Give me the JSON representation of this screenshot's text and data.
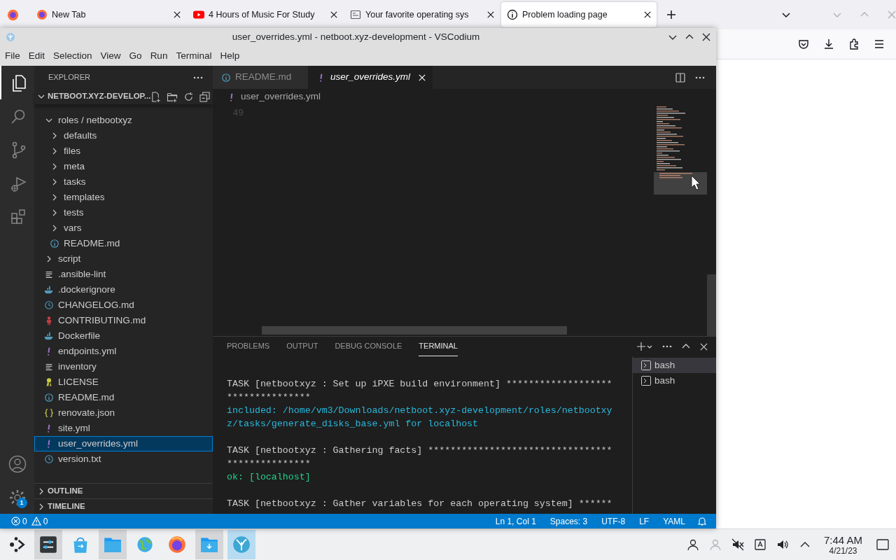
{
  "browser": {
    "tabs": [
      {
        "kind": "firefox",
        "title": "New Tab",
        "selected": false
      },
      {
        "kind": "video",
        "title": "4 Hours of Music For Study",
        "selected": false
      },
      {
        "kind": "page",
        "title": "Your favorite operating sys",
        "selected": false
      },
      {
        "kind": "info",
        "title": "Problem loading page",
        "selected": true
      }
    ]
  },
  "window": {
    "title": "user_overrides.yml - netboot.xyz-development - VSCodium"
  },
  "menu": [
    "File",
    "Edit",
    "Selection",
    "View",
    "Go",
    "Run",
    "Terminal",
    "Help"
  ],
  "activity_bar": {
    "items": [
      {
        "kind": "explorer",
        "selected": true
      },
      {
        "kind": "search",
        "selected": false
      },
      {
        "kind": "source-control",
        "selected": false
      },
      {
        "kind": "run",
        "selected": false
      },
      {
        "kind": "extensions",
        "selected": false
      }
    ],
    "settings_badge": "1"
  },
  "sidebar": {
    "title": "EXPLORER",
    "folder": {
      "name": "NETBOOT.XYZ-DEVELOP...",
      "expanded": true
    },
    "tree": [
      {
        "kind": "folder",
        "name": "roles / netbootxyz",
        "expanded": true,
        "selected": false,
        "children": [
          {
            "kind": "folder",
            "name": "defaults",
            "expanded": false,
            "selected": false
          },
          {
            "kind": "folder",
            "name": "files",
            "expanded": false,
            "selected": false
          },
          {
            "kind": "folder",
            "name": "meta",
            "expanded": false,
            "selected": false
          },
          {
            "kind": "folder",
            "name": "tasks",
            "expanded": false,
            "selected": false
          },
          {
            "kind": "folder",
            "name": "templates",
            "expanded": false,
            "selected": false
          },
          {
            "kind": "folder",
            "name": "tests",
            "expanded": false,
            "selected": false
          },
          {
            "kind": "folder",
            "name": "vars",
            "expanded": false,
            "selected": false
          },
          {
            "kind": "info",
            "name": "README.md",
            "selected": false
          }
        ]
      },
      {
        "kind": "folder",
        "name": "script",
        "expanded": false,
        "selected": false
      },
      {
        "kind": "lines",
        "name": ".ansible-lint",
        "selected": false
      },
      {
        "kind": "docker",
        "name": ".dockerignore",
        "selected": false
      },
      {
        "kind": "clock",
        "name": "CHANGELOG.md",
        "selected": false
      },
      {
        "kind": "person",
        "name": "CONTRIBUTING.md",
        "selected": false
      },
      {
        "kind": "docker",
        "name": "Dockerfile",
        "selected": false
      },
      {
        "kind": "yaml",
        "name": "endpoints.yml",
        "selected": false
      },
      {
        "kind": "lines",
        "name": "inventory",
        "selected": false
      },
      {
        "kind": "license",
        "name": "LICENSE",
        "selected": false
      },
      {
        "kind": "info",
        "name": "README.md",
        "selected": false
      },
      {
        "kind": "json",
        "name": "renovate.json",
        "selected": false
      },
      {
        "kind": "yaml",
        "name": "site.yml",
        "selected": false
      },
      {
        "kind": "yaml",
        "name": "user_overrides.yml",
        "selected": true
      },
      {
        "kind": "clock",
        "name": "version.txt",
        "selected": false
      }
    ],
    "sections": [
      {
        "name": "OUTLINE",
        "expanded": false
      },
      {
        "name": "TIMELINE",
        "expanded": false
      }
    ]
  },
  "editor": {
    "tabs": [
      {
        "kind": "info",
        "title": "README.md",
        "selected": false,
        "preview": false
      },
      {
        "kind": "yaml",
        "title": "user_overrides.yml",
        "selected": true,
        "preview": true
      }
    ],
    "breadcrumb": [
      {
        "kind": "yaml",
        "label": "user_overrides.yml"
      }
    ],
    "line_numbers": [
      "49"
    ]
  },
  "panel": {
    "tabs": [
      {
        "label": "PROBLEMS",
        "selected": false
      },
      {
        "label": "OUTPUT",
        "selected": false
      },
      {
        "label": "DEBUG CONSOLE",
        "selected": false
      },
      {
        "label": "TERMINAL",
        "selected": true
      }
    ],
    "terminal_lines": [
      {
        "kind": "task",
        "text": "TASK [netbootxyz : Set up iPXE build environment] *******************"
      },
      {
        "kind": "task",
        "text": "***************"
      },
      {
        "kind": "included",
        "text": "included: /home/vm3/Downloads/netboot.xyz-development/roles/netbootxy"
      },
      {
        "kind": "included",
        "text": "z/tasks/generate_disks_base.yml for localhost"
      },
      {
        "kind": "blank"
      },
      {
        "kind": "task",
        "text": "TASK [netbootxyz : Gathering facts] *********************************"
      },
      {
        "kind": "task",
        "text": "***************"
      },
      {
        "kind": "ok",
        "text": "ok: [localhost]"
      },
      {
        "kind": "blank"
      },
      {
        "kind": "task",
        "text": "TASK [netbootxyz : Gather variables for each operating system] ******"
      }
    ],
    "terminals": [
      {
        "name": "bash",
        "selected": true
      },
      {
        "name": "bash",
        "selected": false
      }
    ]
  },
  "status_bar": {
    "errors": "0",
    "warnings": "0",
    "items": [
      "Ln 1, Col 1",
      "Spaces: 3",
      "UTF-8",
      "LF",
      "YAML"
    ]
  },
  "taskbar": {
    "apps": [
      {
        "kind": "launcher",
        "active": false
      },
      {
        "kind": "settings",
        "active": true
      },
      {
        "kind": "store",
        "active": false
      },
      {
        "kind": "folder",
        "active": true
      },
      {
        "kind": "globe",
        "active": false
      },
      {
        "kind": "firefox",
        "active": false
      },
      {
        "kind": "downloads",
        "active": true
      },
      {
        "kind": "vscodium",
        "active": true
      }
    ],
    "time": "7:44 AM",
    "date": "4/21/23"
  }
}
